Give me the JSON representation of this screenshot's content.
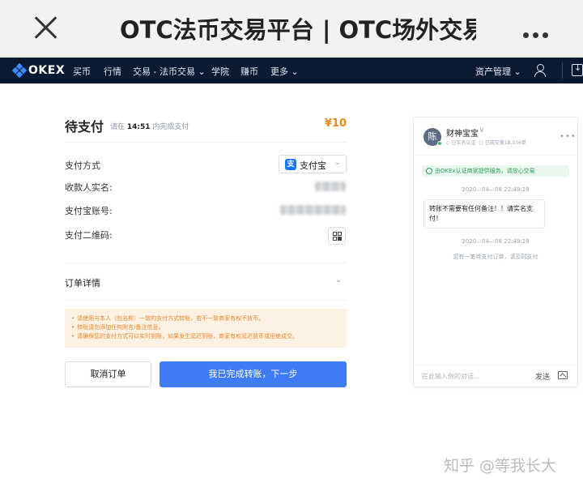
{
  "window": {
    "title": "OTC法币交易平台 | OTC场外交易"
  },
  "nav": {
    "logo": "OKEX",
    "items": [
      "买币",
      "行情",
      "交易 - 法币交易",
      "学院",
      "赚币",
      "更多"
    ],
    "asset_mgmt": "资产管理"
  },
  "payment": {
    "title": "待支付",
    "hint_prefix": "请在",
    "hint_time": "14:51",
    "hint_suffix": "内完成支付",
    "amount": "¥10",
    "method_label": "支付方式",
    "method_value": "支付宝",
    "payee_label": "收款人实名:",
    "account_label": "支付宝账号:",
    "qr_label": "支付二维码:",
    "order_detail": "订单详情",
    "notices": [
      "请使用与本人（包名称）一致的支付方式转账，若不一致商家有权不放币。",
      "转账请勿添加任何附言/备注信息。",
      "请确保您的支付方式可以实时到账，如果发生延迟到账，商家有权延迟放币或拒绝成交。"
    ],
    "cancel_button": "取消订单",
    "confirm_button": "我已完成转账，下一步"
  },
  "chat": {
    "avatar": "陈",
    "name": "财神宝宝",
    "badge": "∨",
    "meta_left": "◇ 已实名认证",
    "meta_right": "▢ 已成交量18,036单",
    "more": "•••",
    "secure_notice": "由OKEx认证商家提供服务，请放心交易",
    "time1": "2020—04—08 22:49:28",
    "message": "转账不需要有任何备注！！请实名支付！",
    "time2": "2020—04—08 22:49:28",
    "system_message": "您有一笔待支付订单，请及时支付",
    "input_placeholder": "在此输入你的对话...",
    "send": "发送"
  },
  "watermark": "知乎 @等我长大"
}
